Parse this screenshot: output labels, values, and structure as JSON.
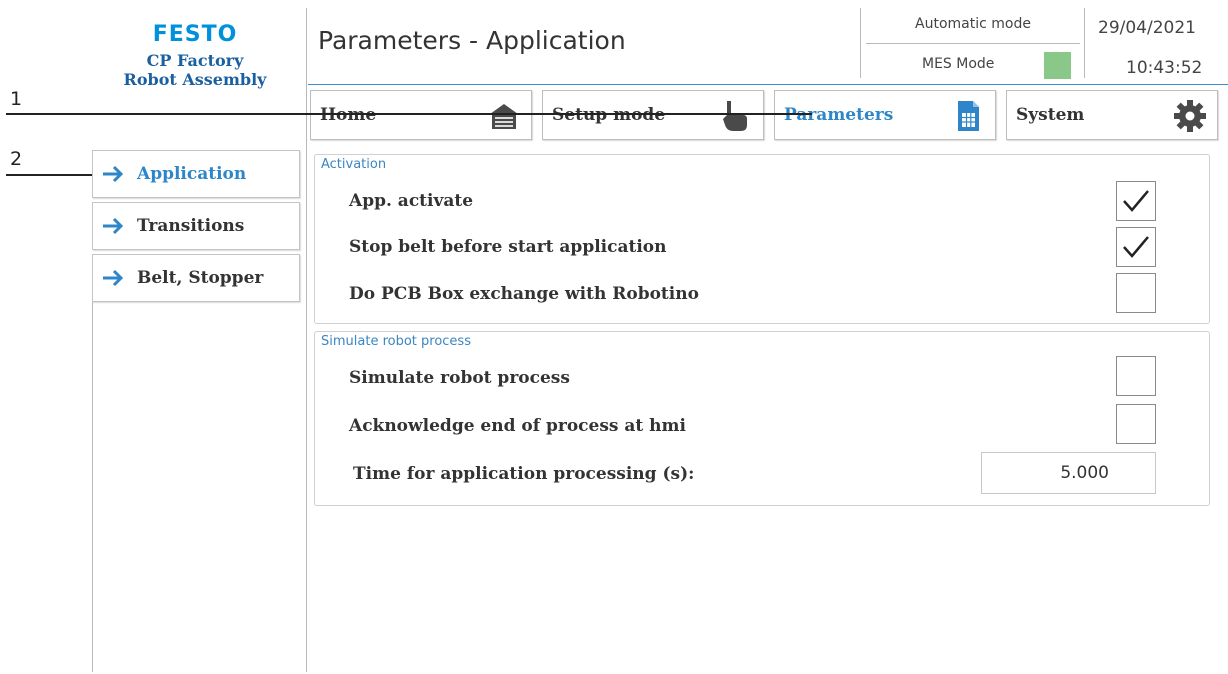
{
  "logo": {
    "brand": "FESTO",
    "line1": "CP Factory",
    "line2": "Robot Assembly"
  },
  "header": {
    "title": "Parameters - Application",
    "mode": "Automatic mode",
    "mes_label": "MES Mode",
    "date": "29/04/2021",
    "time": "10:43:52"
  },
  "nav": {
    "home": "Home",
    "setup": "Setup mode",
    "parameters": "Parameters",
    "system": "System"
  },
  "callouts": {
    "one": "1",
    "two": "2"
  },
  "sidebar": {
    "items": [
      {
        "label": "Application",
        "active": true
      },
      {
        "label": "Transitions",
        "active": false
      },
      {
        "label": "Belt, Stopper",
        "active": false
      }
    ]
  },
  "activation": {
    "title": "Activation",
    "rows": [
      {
        "label": "App. activate",
        "checked": true
      },
      {
        "label": "Stop belt before start application",
        "checked": true
      },
      {
        "label": "Do PCB Box exchange with Robotino",
        "checked": false
      }
    ]
  },
  "simulate": {
    "title": "Simulate robot process",
    "rows": [
      {
        "label": "Simulate robot process",
        "checked": false
      },
      {
        "label": "Acknowledge end of process at hmi",
        "checked": false
      }
    ],
    "time_label": "Time for application processing (s):",
    "time_value": "5.000"
  },
  "colors": {
    "accent": "#2e86c8",
    "brand": "#0091dc",
    "mes_status": "#89c889"
  }
}
